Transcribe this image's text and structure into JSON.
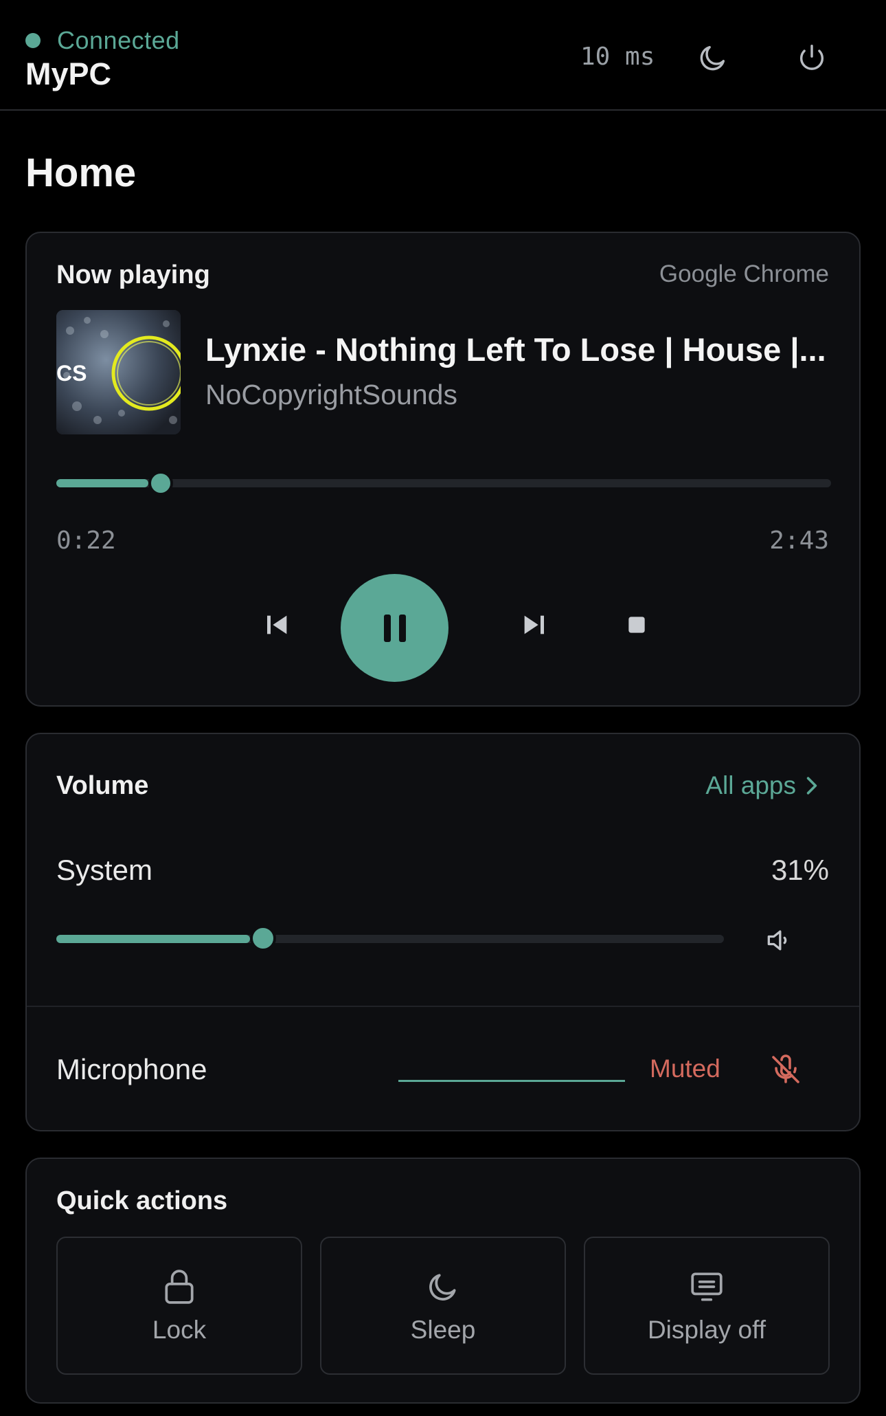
{
  "header": {
    "status": "Connected",
    "device_name": "MyPC",
    "latency": "10 ms",
    "colors": {
      "accent": "#5ba896",
      "muted": "#d46a5e"
    }
  },
  "page": {
    "title": "Home"
  },
  "now_playing": {
    "heading": "Now playing",
    "source": "Google Chrome",
    "album_art_text": "CS",
    "track_title": "Lynxie - Nothing Left To Lose | House |...",
    "artist": "NoCopyrightSounds",
    "elapsed": "0:22",
    "duration": "2:43",
    "progress": 0.135,
    "controls": [
      "previous-icon",
      "pause-icon",
      "next-icon",
      "stop-icon"
    ]
  },
  "volume": {
    "heading": "Volume",
    "all_apps_label": "All apps",
    "system_label": "System",
    "system_percent": "31%",
    "system_level": 0.31,
    "microphone_label": "Microphone",
    "microphone_status": "Muted"
  },
  "quick_actions": {
    "heading": "Quick actions",
    "items": [
      {
        "label": "Lock",
        "icon": "lock-icon"
      },
      {
        "label": "Sleep",
        "icon": "moon-icon"
      },
      {
        "label": "Display off",
        "icon": "display-icon"
      }
    ]
  }
}
